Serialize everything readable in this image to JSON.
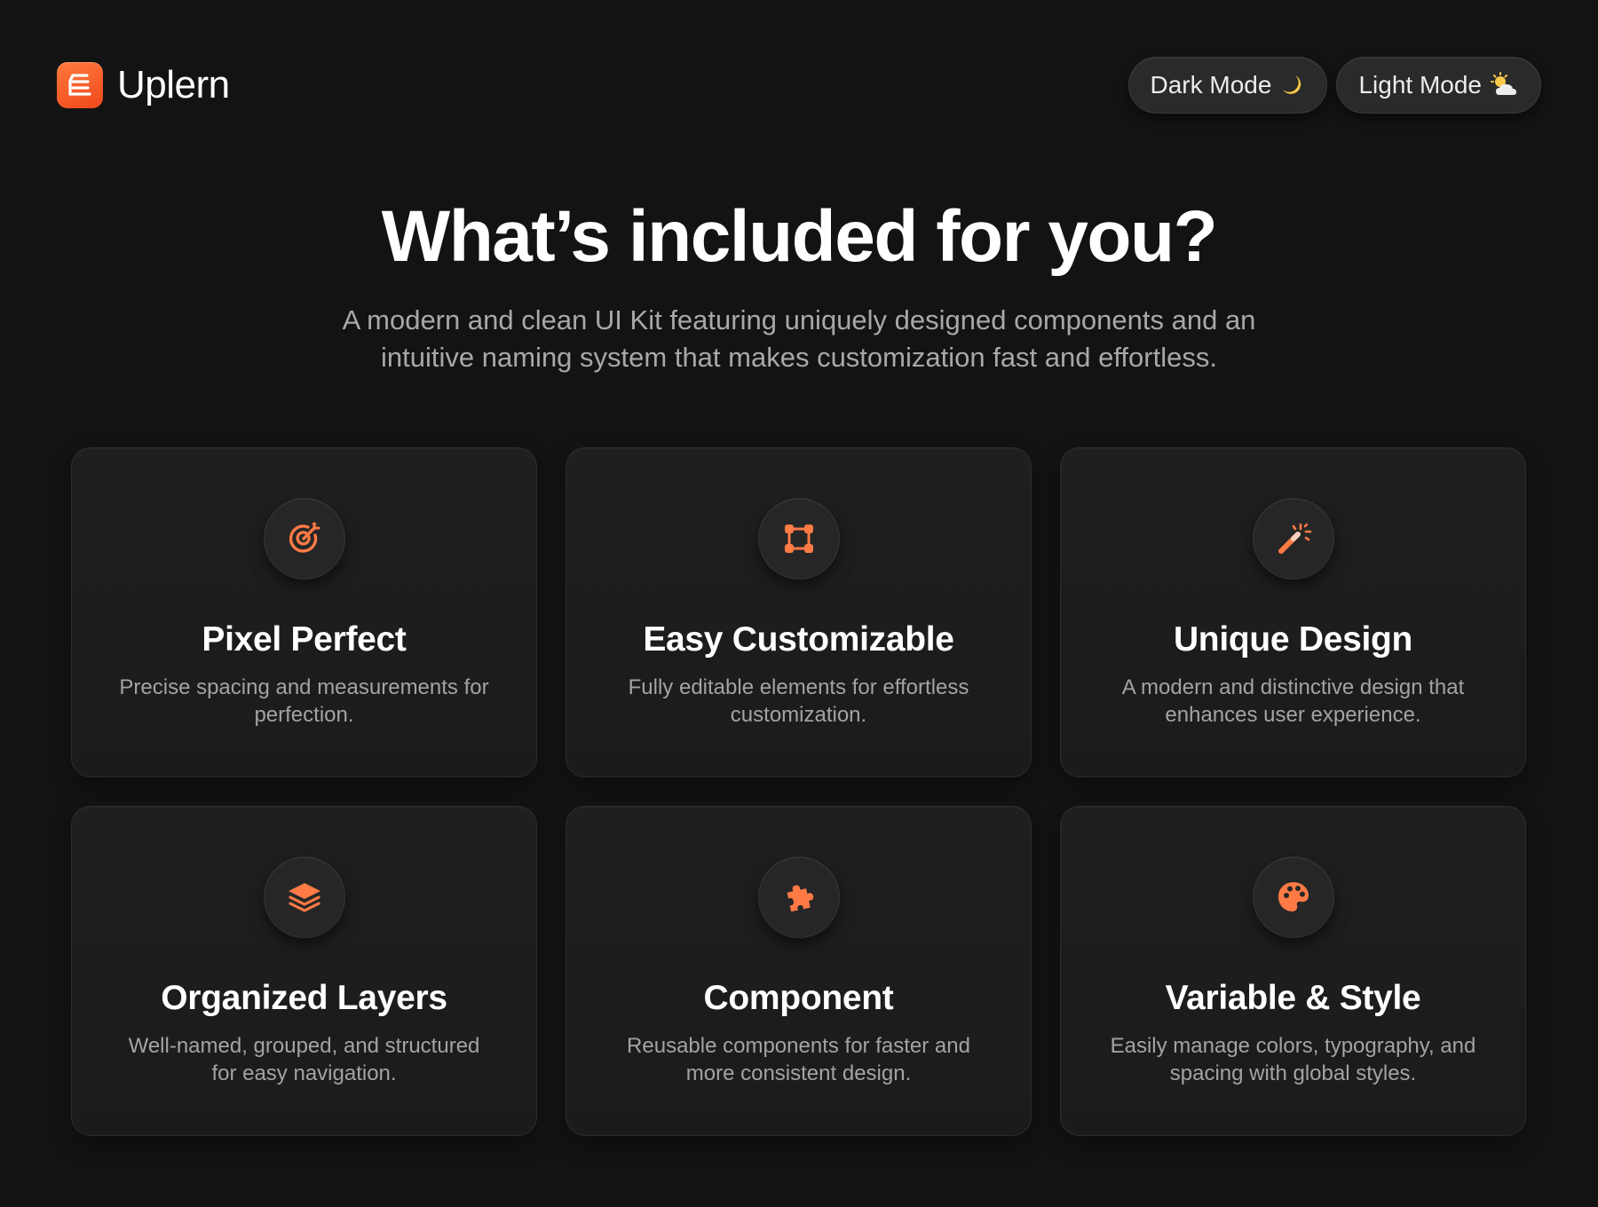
{
  "brand": {
    "name": "Uplern",
    "logo_icon": "stacked-lines-logo-icon"
  },
  "modes": [
    {
      "label": "Dark Mode",
      "icon": "moon-icon"
    },
    {
      "label": "Light Mode",
      "icon": "sun-cloud-icon"
    }
  ],
  "hero": {
    "title": "What’s included for you?",
    "subtitle": "A modern and clean UI Kit featuring uniquely designed components and an intuitive naming system that makes customization fast and effortless."
  },
  "accent_color": "#ff7a45",
  "features": [
    {
      "title": "Pixel Perfect",
      "description": "Precise spacing and measurements for perfection.",
      "icon": "target-icon"
    },
    {
      "title": "Easy Customizable",
      "description": "Fully editable elements for effortless customization.",
      "icon": "vector-square-icon"
    },
    {
      "title": "Unique Design",
      "description": "A modern and distinctive design that enhances user experience.",
      "icon": "magic-wand-icon"
    },
    {
      "title": "Organized Layers",
      "description": "Well-named, grouped, and structured for easy navigation.",
      "icon": "layers-icon"
    },
    {
      "title": "Component",
      "description": "Reusable components for faster and more consistent design.",
      "icon": "puzzle-icon"
    },
    {
      "title": "Variable & Style",
      "description": "Easily manage colors, typography, and spacing with global styles.",
      "icon": "palette-icon"
    }
  ]
}
